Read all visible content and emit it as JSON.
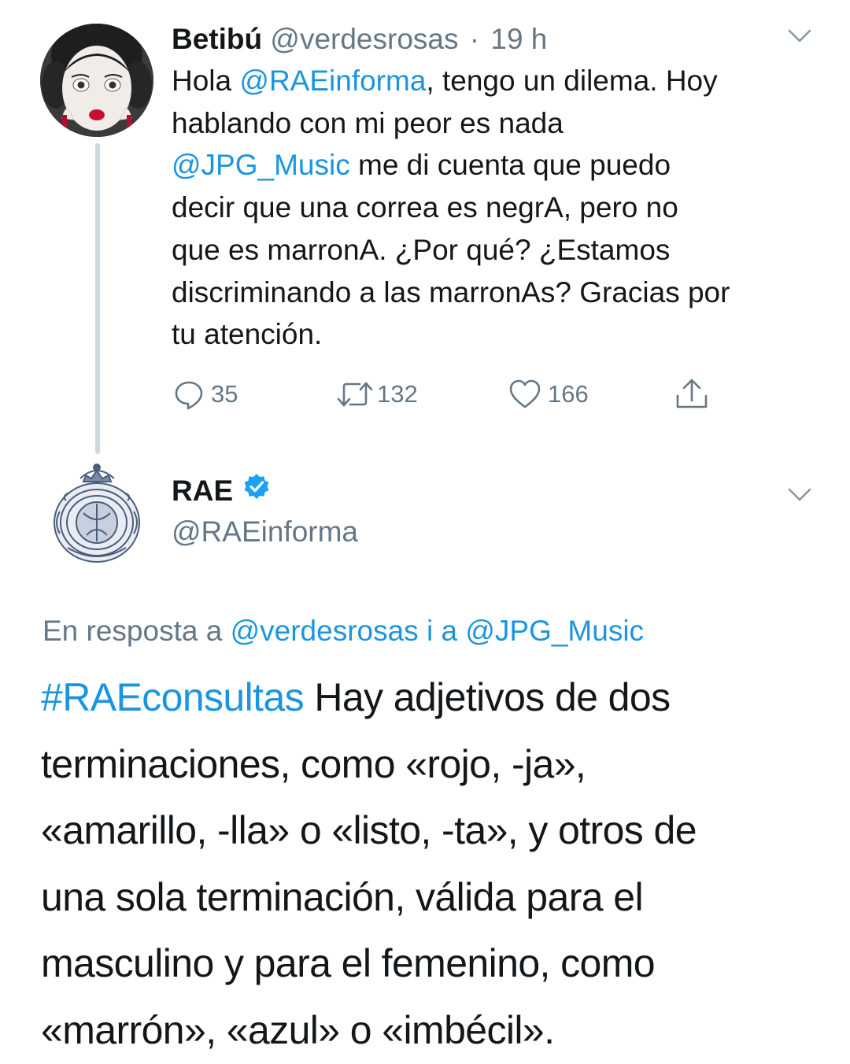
{
  "tweet1": {
    "display_name": "Betibú",
    "handle": "@verdesrosas",
    "separator": "·",
    "time": "19 h",
    "body_lines": [
      {
        "pre": "Hola ",
        "link": "@RAEinforma",
        "post": ", tengo un dilema. Hoy"
      },
      {
        "text": "hablando con mi peor es nada"
      },
      {
        "link": "@JPG_Music",
        "post": " me di cuenta que puedo"
      },
      {
        "text": "decir que una correa es negrA, pero no"
      },
      {
        "text": "que es marronA. ¿Por qué? ¿Estamos"
      },
      {
        "text": "discriminando a las marronAs? Gracias por"
      },
      {
        "text": "tu atención."
      }
    ],
    "actions": {
      "reply_count": "35",
      "retweet_count": "132",
      "like_count": "166"
    },
    "icons": [
      "chevron-down-icon",
      "reply-icon",
      "retweet-icon",
      "heart-icon",
      "share-icon"
    ]
  },
  "tweet2": {
    "display_name": "RAE",
    "verified": true,
    "handle": "@RAEinforma",
    "reply_to": {
      "prefix": "En resposta a ",
      "user1": "@verdesrosas",
      "connector": " i a ",
      "user2": "@JPG_Music"
    },
    "body_lines": [
      {
        "link": "#RAEconsultas",
        "post": " Hay adjetivos de dos"
      },
      {
        "text": "terminaciones, como «rojo, -ja»,"
      },
      {
        "text": "«amarillo, -lla» o «listo, -ta», y otros de"
      },
      {
        "text": "una sola terminación, válida para el"
      },
      {
        "text": "masculino y para el femenino, como"
      },
      {
        "text": "«marrón», «azul» o «imbécil»."
      }
    ]
  },
  "colors": {
    "link": "#1b95e0",
    "secondary_text": "#657786",
    "primary_text": "#14171a",
    "verified_badge": "#1da1f2",
    "thread_line": "#cfd8dd"
  }
}
